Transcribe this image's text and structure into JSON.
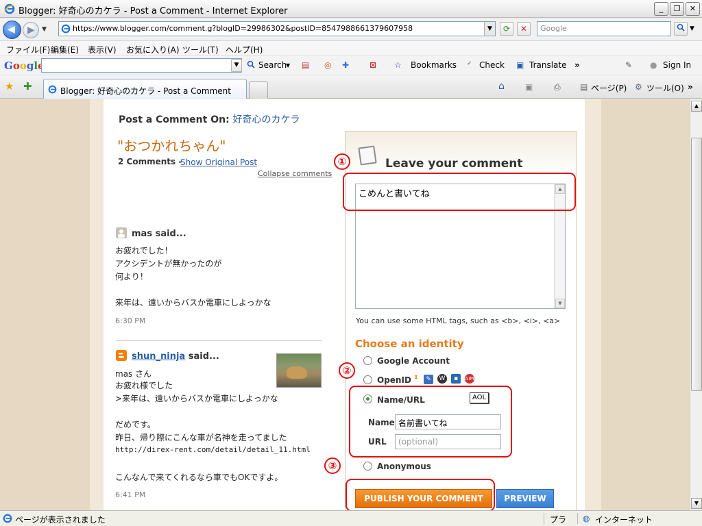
{
  "window": {
    "title": "Blogger: 好奇心のカケラ - Post a Comment - Internet Explorer",
    "minimize": "_",
    "maximize": "❐",
    "close": "✕"
  },
  "address_bar": {
    "url": "https://www.blogger.com/comment.g?blogID=29986302&postID=8547988661379607958",
    "search_placeholder": "Google"
  },
  "menu": [
    "ファイル(F)",
    "編集(E)",
    "表示(V)",
    "お気に入り(A)",
    "ツール(T)",
    "ヘルプ(H)"
  ],
  "google_toolbar": {
    "logo": "Google",
    "search_label": "Search",
    "bookmarks_label": "Bookmarks",
    "check_label": "Check",
    "translate_label": "Translate",
    "more": "»",
    "signin_label": "Sign In"
  },
  "tabs": {
    "active_tab": "Blogger: 好奇心のカケラ - Post a Comment",
    "page_menu": "ページ(P)",
    "tools_menu": "ツール(O)"
  },
  "post": {
    "heading_prefix": "Post a Comment On:",
    "blog_name": "好奇心のカケラ",
    "title": "\"おつかれちゃん\"",
    "comment_count": "2 Comments -",
    "show_original": "Show Original Post",
    "collapse": "Collapse comments"
  },
  "comments": [
    {
      "author": "mas",
      "said": "said...",
      "lines": [
        "お疲れでした！",
        "アクシデントが無かったのが",
        "何より！",
        "",
        "来年は、遠いからバスか電車にしよっかな"
      ],
      "time": "6:30 PM"
    },
    {
      "author": "shun_ninja",
      "said": "said...",
      "lines": [
        "mas さん",
        "お疲れ様でした",
        ">来年は、遠いからバスか電車にしよっかな",
        "",
        "だめです。",
        "昨日、帰り際にこんな車が名神を走ってました",
        "http://direx-rent.com/detail/detail_11.html",
        "",
        "こんなんで来てくれるなら車でもOKですよ。"
      ],
      "time": "6:41 PM"
    }
  ],
  "form": {
    "leave_title": "Leave your comment",
    "comment_text": "こめんと書いてね",
    "html_hint": "You can use some HTML tags, such as <b>, <i>, <a>",
    "choose_identity": "Choose an identity",
    "options": {
      "google": "Google Account",
      "openid": "OpenID",
      "name_url": "Name/URL",
      "anonymous": "Anonymous"
    },
    "selected_option": "Name/URL",
    "aol_tooltip": "AOL",
    "name_label": "Name",
    "name_value": "名前書いてね",
    "url_label": "URL",
    "url_placeholder": "(optional)",
    "publish_label": "PUBLISH YOUR COMMENT",
    "preview_label": "PREVIEW"
  },
  "annotations": [
    "①",
    "②",
    "③"
  ],
  "status_bar": {
    "message": "ページが表示されました",
    "plugin": "プラ",
    "zone": "インターネット"
  },
  "colors": {
    "annotation_red": "#e01010",
    "title_orange": "#cc6a14",
    "publish_orange": "#e46f08",
    "preview_blue": "#3a7fd3",
    "link_blue": "#2b5ea8"
  }
}
